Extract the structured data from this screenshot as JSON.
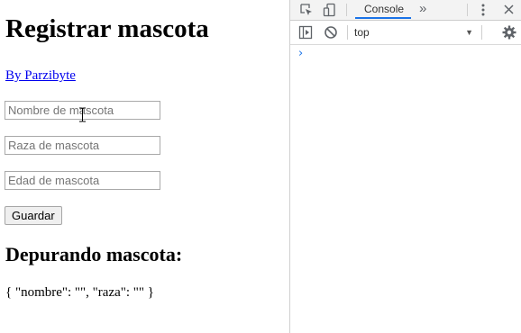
{
  "page": {
    "title": "Registrar mascota",
    "author_link": "By Parzibyte",
    "fields": [
      {
        "placeholder": "Nombre de mascota",
        "value": ""
      },
      {
        "placeholder": "Raza de mascota",
        "value": ""
      },
      {
        "placeholder": "Edad de mascota",
        "value": ""
      }
    ],
    "save_label": "Guardar",
    "debug_heading": "Depurando mascota:",
    "debug_output": "{ \"nombre\": \"\", \"raza\": \"\" }"
  },
  "devtools": {
    "tabs": {
      "active": "Console",
      "more": "»"
    },
    "toolbar": {
      "context": "top",
      "context_arrow": "▼"
    },
    "console": {
      "prompt_symbol": "›"
    },
    "icons": [
      "inspect-element-icon",
      "device-toolbar-icon",
      "more-tabs-icon",
      "kebab-menu-icon",
      "close-icon",
      "sidebar-toggle-icon",
      "clear-console-icon",
      "settings-gear-icon",
      "text-cursor-icon"
    ],
    "accent_color": "#1a73e8"
  }
}
